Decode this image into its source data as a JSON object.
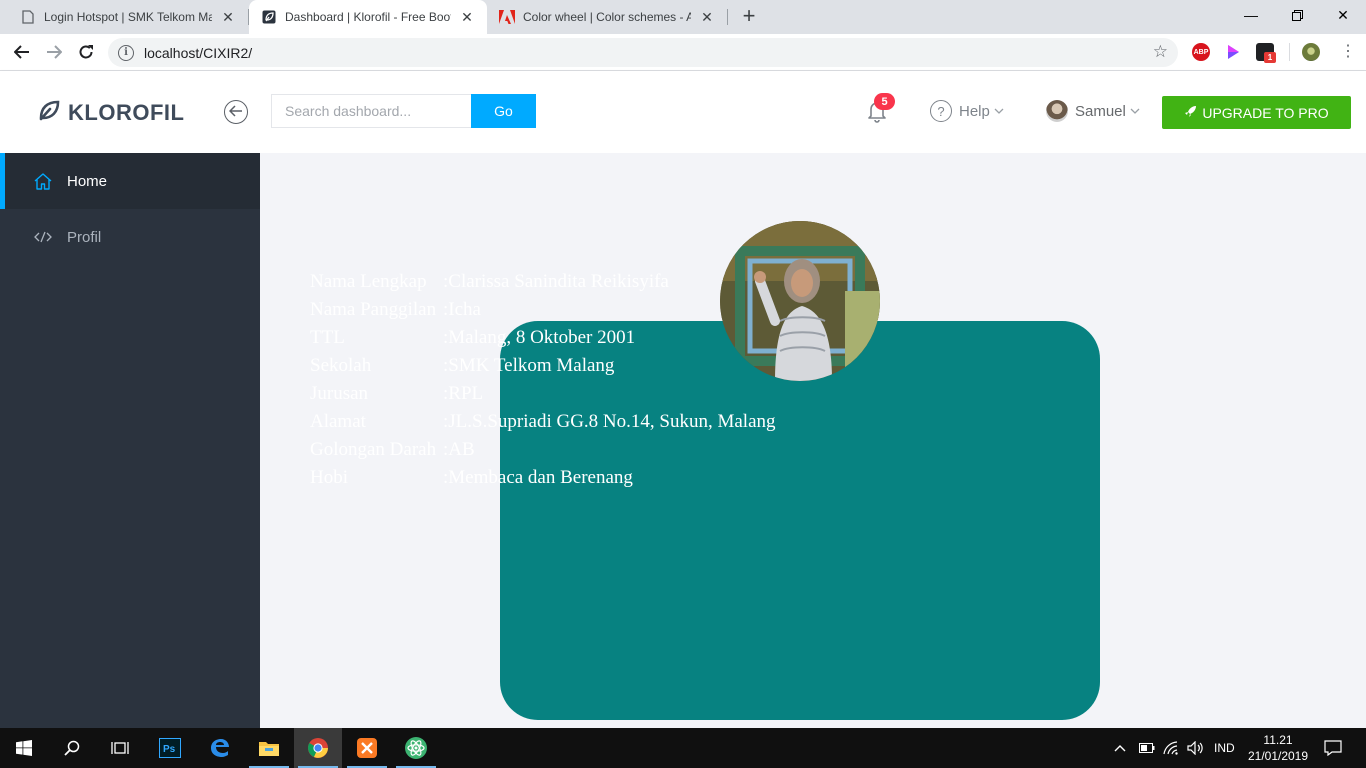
{
  "browser": {
    "tabs": [
      {
        "title": "Login Hotspot | SMK Telkom Mal",
        "icon": "page-icon",
        "active": false
      },
      {
        "title": "Dashboard | Klorofil - Free Boots",
        "icon": "klorofil-leaf-icon",
        "active": true
      },
      {
        "title": "Color wheel | Color schemes - Ad",
        "icon": "adobe-icon",
        "active": false
      }
    ],
    "url": "localhost/CIXIR2/",
    "extensions": [
      {
        "name": "abp-icon",
        "label": "ABP",
        "color": "#d8141d"
      },
      {
        "name": "play-extension-icon",
        "color": "#7b4dff"
      },
      {
        "name": "extension-badge-icon",
        "badge": "1",
        "color": "#e53935"
      },
      {
        "name": "profile-avatar-icon",
        "color": "#7a8a4a"
      }
    ]
  },
  "header": {
    "brand": "KLOROFIL",
    "search_placeholder": "Search dashboard...",
    "go_label": "Go",
    "notifications_count": "5",
    "help_label": "Help",
    "user_name": "Samuel",
    "upgrade_label": "UPGRADE TO PRO",
    "accent": "#00aaff",
    "upgrade_color": "#41b314"
  },
  "sidebar": {
    "items": [
      {
        "label": "Home",
        "icon": "home-icon",
        "active": true
      },
      {
        "label": "Profil",
        "icon": "code-icon",
        "active": false
      }
    ]
  },
  "profile": {
    "card_color": "#078281",
    "rows": [
      {
        "key": "Nama Lengkap",
        "value": ":Clarissa Sanindita Reikisyifa"
      },
      {
        "key": "Nama Panggilan",
        "value": ":Icha"
      },
      {
        "key": "TTL",
        "value": ":Malang, 8 Oktober 2001"
      },
      {
        "key": "Sekolah",
        "value": ":SMK Telkom Malang"
      },
      {
        "key": "Jurusan",
        "value": ":RPL"
      },
      {
        "key": "Alamat",
        "value": ":JL.S.Supriadi GG.8 No.14, Sukun, Malang"
      },
      {
        "key": "Golongan Darah",
        "value": ":AB"
      },
      {
        "key": "Hobi",
        "value": ":Membaca dan Berenang"
      }
    ]
  },
  "taskbar": {
    "apps": [
      "windows-start-icon",
      "search-icon",
      "task-view-icon",
      "photoshop-icon",
      "edge-icon",
      "file-explorer-icon",
      "chrome-icon",
      "xampp-icon",
      "atom-icon"
    ],
    "language": "IND",
    "time": "11.21",
    "date": "21/01/2019"
  }
}
